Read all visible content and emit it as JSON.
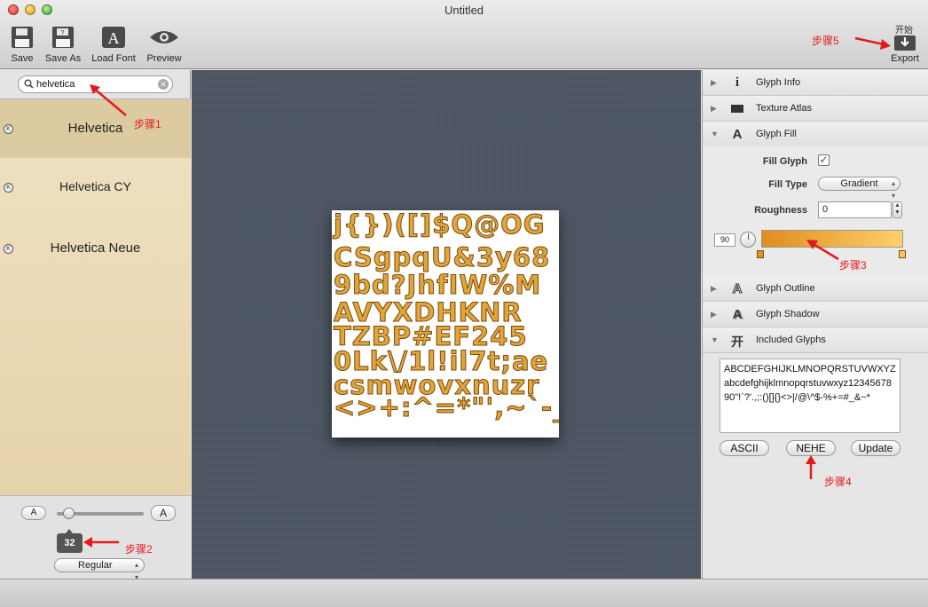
{
  "window": {
    "title": "Untitled"
  },
  "toolbar": {
    "save": "Save",
    "save_as": "Save As",
    "load_font": "Load Font",
    "preview": "Preview",
    "export": "Export",
    "export_badge": "开始"
  },
  "search": {
    "value": "helvetica"
  },
  "fonts": [
    {
      "name": "Helvetica",
      "badge": "K",
      "selected": true
    },
    {
      "name": "Helvetica CY",
      "badge": "K",
      "selected": false
    },
    {
      "name": "Helvetica Neue",
      "badge": "K",
      "selected": false
    }
  ],
  "size_controls": {
    "smaller": "A",
    "larger": "A",
    "size": "32",
    "style": "Regular"
  },
  "atlas": {
    "rows": [
      "j{})([]$Q@OG",
      "CSgpqU&3y68",
      "9bd?JhfIW%M",
      "AVYXDHKNR",
      "TZBP#EF245",
      "0Lk\\/1l!il7t;ae",
      "csmwovxnuzr",
      "<>+:^=*\"',~`-_"
    ],
    "fill_color": "#e1a53b",
    "outline_color": "#7a4a0b"
  },
  "inspector": {
    "sections": {
      "glyph_info": "Glyph Info",
      "texture_atlas": "Texture Atlas",
      "glyph_fill": "Glyph Fill",
      "glyph_outline": "Glyph Outline",
      "glyph_shadow": "Glyph Shadow",
      "included_glyphs": "Included Glyphs"
    },
    "fill": {
      "fill_glyph_label": "Fill Glyph",
      "fill_glyph_checked": true,
      "fill_type_label": "Fill Type",
      "fill_type_value": "Gradient",
      "roughness_label": "Roughness",
      "roughness_value": "0",
      "angle_value": "90",
      "gradient_start": "#df8e1e",
      "gradient_end": "#ffcf6a"
    },
    "included_glyphs_text": "ABCDEFGHIJKLMNOPQRSTUVWXYZabcdefghijklmnopqrstuvwxyz1234567890\"!`?'.,;:()[]{}<>|/@\\^$-%+=#_&~*",
    "buttons": {
      "ascii": "ASCII",
      "nehe": "NEHE",
      "update": "Update"
    }
  },
  "annotations": {
    "step1": "步骤1",
    "step2": "步骤2",
    "step3": "步骤3",
    "step4": "步骤4",
    "step5": "步骤5"
  }
}
